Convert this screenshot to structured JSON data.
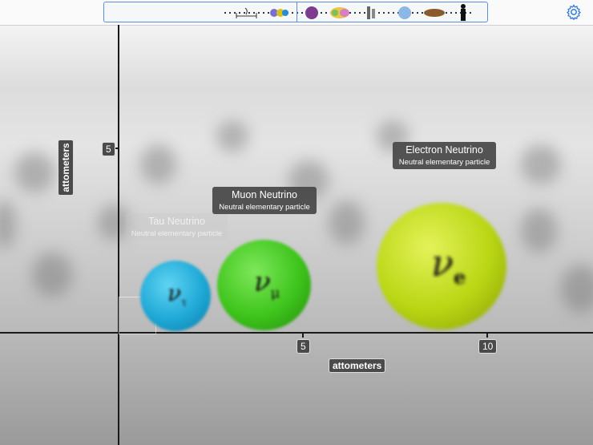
{
  "toolbar": {
    "settings_icon": "gear-icon",
    "scale_strip_icons": [
      "ruler-icon",
      "quark-icon",
      "virus-icon",
      "cell-icon",
      "dna-icon",
      "globe-cell-icon",
      "insect-icon",
      "human-silhouette-icon"
    ]
  },
  "axes": {
    "x_label": "attometers",
    "y_label": "attometers",
    "x_ticks": [
      "5",
      "10"
    ],
    "y_ticks": [
      "5"
    ]
  },
  "particles": [
    {
      "name": "Tau Neutrino",
      "subtitle": "Neutral elementary particle",
      "symbol": "ν",
      "sub": "τ",
      "color": "#1fa8d6"
    },
    {
      "name": "Muon Neutrino",
      "subtitle": "Neutral elementary particle",
      "symbol": "ν",
      "sub": "μ",
      "color": "#3ec41c"
    },
    {
      "name": "Electron Neutrino",
      "subtitle": "Neutral elementary particle",
      "symbol": "ν",
      "sub": "e",
      "color": "#b9d613"
    }
  ]
}
